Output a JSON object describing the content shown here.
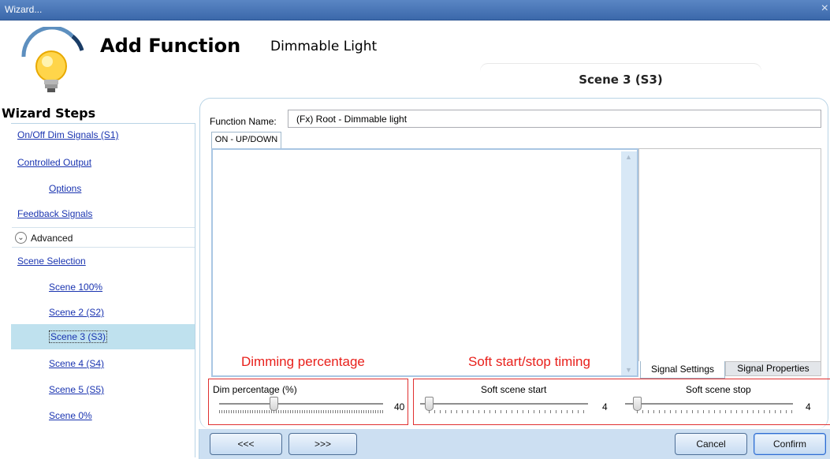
{
  "window": {
    "title": "Wizard...",
    "close_glyph": "×"
  },
  "header": {
    "title": "Add Function",
    "subtitle": "Dimmable Light",
    "scene_tab": "Scene 3 (S3)",
    "icon": "light-bulb-icon"
  },
  "wizard": {
    "title": "Wizard Steps",
    "items": [
      {
        "label": "On/Off Dim Signals (S1)"
      },
      {
        "label": "Controlled Output"
      },
      {
        "label": "Options"
      },
      {
        "label": "Feedback Signals"
      }
    ],
    "advanced": {
      "label": "Advanced",
      "icon": "chevron-down-circle-icon"
    },
    "scene_items": [
      {
        "label": "Scene Selection"
      },
      {
        "label": "Scene 100%"
      },
      {
        "label": "Scene 2 (S2)"
      },
      {
        "label": "Scene 3 (S3)",
        "selected": true
      },
      {
        "label": "Scene 4 (S4)"
      },
      {
        "label": "Scene 5 (S5)"
      },
      {
        "label": "Scene 0%"
      }
    ]
  },
  "main": {
    "function_name_label": "Function Name:",
    "function_name_value": "(Fx) Root - Dimmable light",
    "tab": "ON - UP/DOWN",
    "signal_tabs": [
      "Signal Settings",
      "Signal Properties"
    ]
  },
  "annotations": {
    "dimming": "Dimming percentage",
    "soft": "Soft start/stop timing",
    "color": "#e8201b"
  },
  "sliders": {
    "dim": {
      "label": "Dim percentage (%)",
      "value": "40"
    },
    "soft_start": {
      "label": "Soft scene start",
      "value": "4"
    },
    "soft_stop": {
      "label": "Soft scene stop",
      "value": "4"
    }
  },
  "footer": {
    "prev": "<<<",
    "next": ">>>",
    "cancel": "Cancel",
    "confirm": "Confirm"
  }
}
